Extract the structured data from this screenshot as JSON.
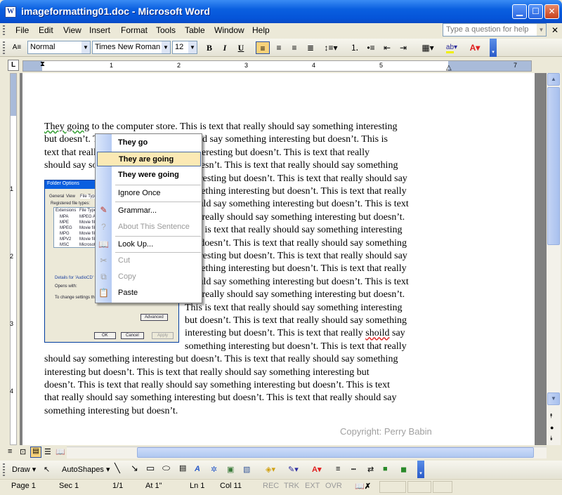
{
  "window": {
    "title": "imageformatting01.doc - Microsoft Word",
    "app_icon": "W"
  },
  "menubar": {
    "items": [
      "File",
      "Edit",
      "View",
      "Insert",
      "Format",
      "Tools",
      "Table",
      "Window",
      "Help"
    ],
    "ask_placeholder": "Type a question for help"
  },
  "toolbar": {
    "style": "Normal",
    "font": "Times New Roman",
    "size": "12",
    "bold": "B",
    "italic": "I",
    "underline": "U"
  },
  "ruler": {
    "marks": [
      "1",
      "2",
      "3",
      "4",
      "5",
      "7"
    ],
    "tab_selector": "L",
    "vertical_marks": [
      "1",
      "2",
      "3",
      "4"
    ]
  },
  "document": {
    "lines": [
      "They going to the computer store. This is text that really should say something interesting",
      "but doesn’t. This is text that really should say something interesting but doesn’t. This is",
      "text that really should say something interesting but doesn’t. This is text that really",
      "should say something interesting but doesn’t. This is text that really should say something",
      "interesting but doesn’t. This is text that really should say",
      "something interesting but doesn’t. This is text that really",
      "should say something interesting but doesn’t. This is text",
      "that really should say something interesting but doesn’t.",
      "This is text that really should say something interesting",
      "but doesn’t. This is text that really should say something",
      "interesting but doesn’t. This is text that really should say",
      "something interesting but doesn’t. This is text that really",
      "should say something interesting but doesn’t. This is text",
      "that really should say something interesting but doesn’t.",
      "This is text that really should say something interesting",
      "but doesn’t. This is text that really should say something",
      "interesting but doesn’t. This is text that really should say",
      "something interesting but doesn’t. This is text that really",
      "should say something interesting but doesn’t. This is text that really should say something",
      "interesting but doesn’t. This is text that really should say something interesting but",
      "doesn’t. This is text that really should say something interesting but doesn’t. This is text",
      "that really should say something interesting but doesn’t. This is text that really should say",
      "something interesting but doesn’t."
    ],
    "copyright": "Copyright: Perry Babin"
  },
  "embedded_dialog": {
    "title": "Folder Options",
    "tabs": [
      "General",
      "View",
      "File Types"
    ],
    "label_registered": "Registered file types:",
    "col1": "Extensions",
    "col2": "File Types",
    "rows": [
      [
        "MPA",
        "MPEG Aud"
      ],
      [
        "MPE",
        "Movie file"
      ],
      [
        "MPEG",
        "Movie file"
      ],
      [
        "MPG",
        "Movie file"
      ],
      [
        "MPV2",
        "Movie file"
      ],
      [
        "MSC",
        "Microsoft"
      ]
    ],
    "details": "Details for 'AudioCD' file",
    "opens_with": "Opens with:",
    "change": "To change settings that",
    "advanced": "Advanced",
    "ok": "OK",
    "cancel": "Cancel",
    "apply": "Apply"
  },
  "context_menu": {
    "suggestions": [
      "They go",
      "They are going",
      "They were going"
    ],
    "ignore": "Ignore Once",
    "grammar": "Grammar...",
    "about": "About This Sentence",
    "lookup": "Look Up...",
    "cut": "Cut",
    "copy": "Copy",
    "paste": "Paste"
  },
  "drawbar": {
    "draw": "Draw",
    "autoshapes": "AutoShapes"
  },
  "statusbar": {
    "page": "Page 1",
    "sec": "Sec 1",
    "pages": "1/1",
    "at": "At 1\"",
    "ln": "Ln 1",
    "col": "Col 11",
    "rec": "REC",
    "trk": "TRK",
    "ext": "EXT",
    "ovr": "OVR"
  },
  "colors": {
    "title_blue": "#0a5fe0",
    "highlight": "#f8d27a",
    "font_color": "#e02020"
  }
}
